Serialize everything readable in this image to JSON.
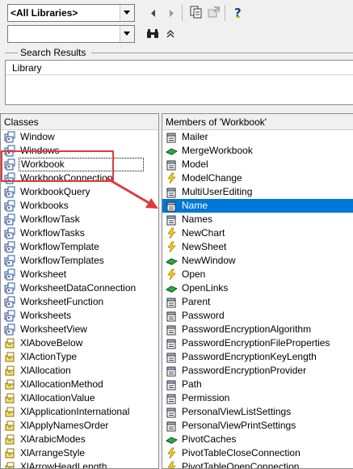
{
  "toolbar": {
    "library_value": "<All Libraries>",
    "search_value": "",
    "back_icon": "back-arrow-icon",
    "forward_icon": "forward-arrow-icon",
    "copy_icon": "copy-icon",
    "view_definition_icon": "view-definition-icon",
    "help_icon": "help-icon",
    "find_icon": "binoculars-icon",
    "toggle_icon": "double-chevron-up-icon"
  },
  "search_results": {
    "title": "Search Results",
    "column_header": "Library"
  },
  "classes": {
    "header": "Classes",
    "items": [
      {
        "label": "Window",
        "icon": "class-icon"
      },
      {
        "label": "Windows",
        "icon": "class-icon"
      },
      {
        "label": "Workbook",
        "icon": "class-icon"
      },
      {
        "label": "WorkbookConnection",
        "icon": "class-icon"
      },
      {
        "label": "WorkbookQuery",
        "icon": "class-icon"
      },
      {
        "label": "Workbooks",
        "icon": "class-icon"
      },
      {
        "label": "WorkflowTask",
        "icon": "class-icon"
      },
      {
        "label": "WorkflowTasks",
        "icon": "class-icon"
      },
      {
        "label": "WorkflowTemplate",
        "icon": "class-icon"
      },
      {
        "label": "WorkflowTemplates",
        "icon": "class-icon"
      },
      {
        "label": "Worksheet",
        "icon": "class-icon"
      },
      {
        "label": "WorksheetDataConnection",
        "icon": "class-icon"
      },
      {
        "label": "WorksheetFunction",
        "icon": "class-icon"
      },
      {
        "label": "Worksheets",
        "icon": "class-icon"
      },
      {
        "label": "WorksheetView",
        "icon": "class-icon"
      },
      {
        "label": "XlAboveBelow",
        "icon": "enum-icon"
      },
      {
        "label": "XlActionType",
        "icon": "enum-icon"
      },
      {
        "label": "XlAllocation",
        "icon": "enum-icon"
      },
      {
        "label": "XlAllocationMethod",
        "icon": "enum-icon"
      },
      {
        "label": "XlAllocationValue",
        "icon": "enum-icon"
      },
      {
        "label": "XlApplicationInternational",
        "icon": "enum-icon"
      },
      {
        "label": "XlApplyNamesOrder",
        "icon": "enum-icon"
      },
      {
        "label": "XlArabicModes",
        "icon": "enum-icon"
      },
      {
        "label": "XlArrangeStyle",
        "icon": "enum-icon"
      },
      {
        "label": "XlArrowHeadLength",
        "icon": "enum-icon"
      }
    ]
  },
  "members": {
    "header": "Members of 'Workbook'",
    "items": [
      {
        "label": "Mailer",
        "icon": "property-icon"
      },
      {
        "label": "MergeWorkbook",
        "icon": "method-icon"
      },
      {
        "label": "Model",
        "icon": "property-icon"
      },
      {
        "label": "ModelChange",
        "icon": "event-icon"
      },
      {
        "label": "MultiUserEditing",
        "icon": "property-icon"
      },
      {
        "label": "Name",
        "icon": "property-icon"
      },
      {
        "label": "Names",
        "icon": "property-icon"
      },
      {
        "label": "NewChart",
        "icon": "event-icon"
      },
      {
        "label": "NewSheet",
        "icon": "event-icon"
      },
      {
        "label": "NewWindow",
        "icon": "method-icon"
      },
      {
        "label": "Open",
        "icon": "event-icon"
      },
      {
        "label": "OpenLinks",
        "icon": "method-icon"
      },
      {
        "label": "Parent",
        "icon": "property-icon"
      },
      {
        "label": "Password",
        "icon": "property-icon"
      },
      {
        "label": "PasswordEncryptionAlgorithm",
        "icon": "property-icon"
      },
      {
        "label": "PasswordEncryptionFileProperties",
        "icon": "property-icon"
      },
      {
        "label": "PasswordEncryptionKeyLength",
        "icon": "property-icon"
      },
      {
        "label": "PasswordEncryptionProvider",
        "icon": "property-icon"
      },
      {
        "label": "Path",
        "icon": "property-icon"
      },
      {
        "label": "Permission",
        "icon": "property-icon"
      },
      {
        "label": "PersonalViewListSettings",
        "icon": "property-icon"
      },
      {
        "label": "PersonalViewPrintSettings",
        "icon": "property-icon"
      },
      {
        "label": "PivotCaches",
        "icon": "method-icon"
      },
      {
        "label": "PivotTableCloseConnection",
        "icon": "event-icon"
      },
      {
        "label": "PivotTableOpenConnection",
        "icon": "event-icon"
      }
    ]
  },
  "annotation": {
    "highlight_color": "#e03a3a",
    "selection_color": "#0078d7"
  }
}
